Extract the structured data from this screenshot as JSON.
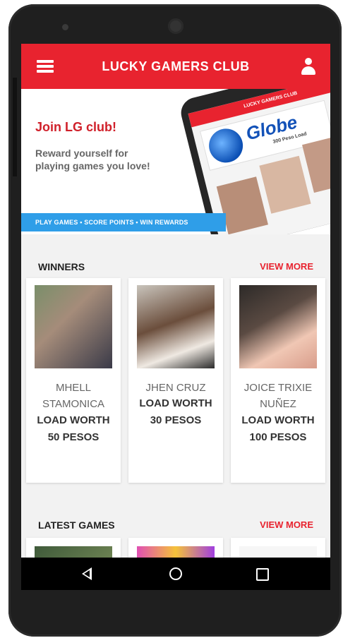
{
  "app": {
    "title": "LUCKY GAMERS CLUB"
  },
  "banner": {
    "title": "Join LG club!",
    "subtitle": "Reward yourself for playing games you love!",
    "ribbon": "PLAY GAMES • SCORE POINTS • WIN REWARDS",
    "promo": {
      "bar_title": "LUCKY GAMERS CLUB",
      "brand": "Globe",
      "load": "300 Peso Load"
    }
  },
  "winners": {
    "title": "WINNERS",
    "view_more": "VIEW MORE",
    "items": [
      {
        "name": "MHELL STAMONICA",
        "prize_line1": "LOAD WORTH",
        "prize_line2": "50 PESOS"
      },
      {
        "name": "JHEN CRUZ",
        "prize_line1": "LOAD WORTH",
        "prize_line2": "30 PESOS"
      },
      {
        "name": "JOICE TRIXIE NUÑEZ",
        "prize_line1": "LOAD WORTH",
        "prize_line2": "100 PESOS"
      }
    ]
  },
  "latest_games": {
    "title": "LATEST GAMES",
    "view_more": "VIEW MORE"
  },
  "colors": {
    "accent": "#e8232f",
    "ribbon": "#2f9ee8",
    "brand_blue": "#1352b8"
  }
}
